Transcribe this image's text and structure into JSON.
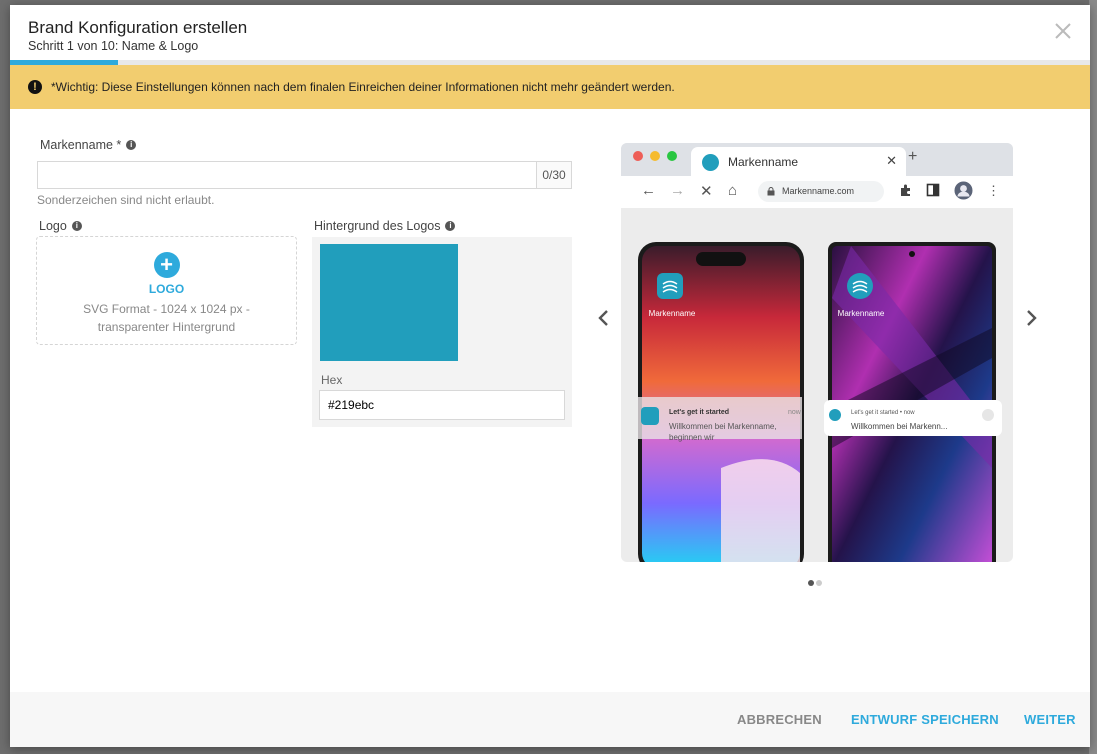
{
  "dialog": {
    "title": "Brand Konfiguration erstellen",
    "step": "Schritt 1 von 10: Name & Logo",
    "progress_fraction": 0.1
  },
  "alert": {
    "text": "*Wichtig: Diese Einstellungen können nach dem finalen Einreichen deiner Informationen nicht mehr geändert werden."
  },
  "form": {
    "brand_name_label": "Markenname *",
    "brand_name_value": "",
    "brand_name_counter": "0/30",
    "brand_name_hint": "Sonderzeichen sind nicht erlaubt.",
    "logo_label": "Logo",
    "logo_upload_text": "LOGO",
    "logo_upload_desc": "SVG Format - 1024 x 1024 px - transparenter Hintergrund",
    "logo_bg_label": "Hintergrund des Logos",
    "hex_label": "Hex",
    "hex_value": "#219ebc"
  },
  "preview": {
    "tab_title": "Markenname",
    "url": "Markenname.com",
    "app_name": "Markenname",
    "notif_title": "Let's get it started",
    "notif_time": "now",
    "notif_text_ios": "Willkommen bei Markenname, beginnen wir",
    "notif_text_android": "Willkommen bei Markenn...",
    "android_notif_title": "Let's get it started • now",
    "carousel_active_index": 0
  },
  "footer": {
    "cancel_label": "ABBRECHEN",
    "draft_label": "ENTWURF SPEICHERN",
    "next_label": "WEITER"
  },
  "colors": {
    "accent": "#2eaadc",
    "alert_bg": "#f2cd6f",
    "logo_bg": "#219ebc"
  }
}
